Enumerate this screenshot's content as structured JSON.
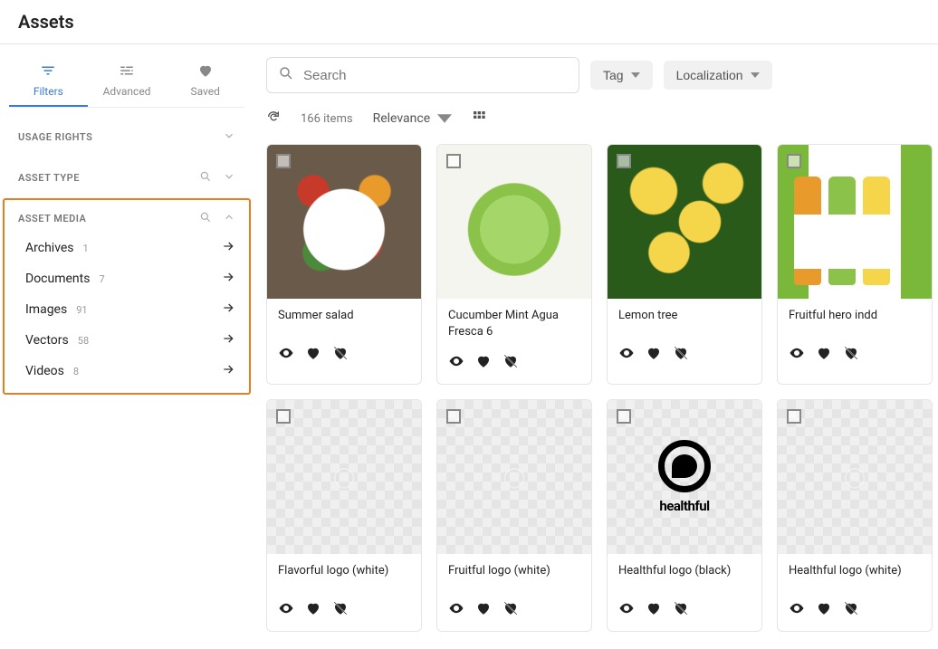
{
  "page": {
    "title": "Assets"
  },
  "tabs": [
    {
      "label": "Filters",
      "active": true
    },
    {
      "label": "Advanced",
      "active": false
    },
    {
      "label": "Saved",
      "active": false
    }
  ],
  "filters": {
    "usage_rights": {
      "label": "USAGE RIGHTS"
    },
    "asset_type": {
      "label": "ASSET TYPE"
    },
    "asset_media": {
      "label": "ASSET MEDIA",
      "items": [
        {
          "label": "Archives",
          "count": "1"
        },
        {
          "label": "Documents",
          "count": "7"
        },
        {
          "label": "Images",
          "count": "91"
        },
        {
          "label": "Vectors",
          "count": "58"
        },
        {
          "label": "Videos",
          "count": "8"
        }
      ]
    }
  },
  "search": {
    "placeholder": "Search"
  },
  "topbar": {
    "tag_label": "Tag",
    "localization_label": "Localization"
  },
  "toolbar": {
    "count_text": "166 items",
    "sort_label": "Relevance"
  },
  "assets": [
    {
      "title": "Summer salad",
      "thumb_class": "salad"
    },
    {
      "title": "Cucumber Mint Agua Fresca 6",
      "thumb_class": "cucumber"
    },
    {
      "title": "Lemon tree",
      "thumb_class": "lemon"
    },
    {
      "title": "Fruitful hero indd",
      "thumb_class": "bottles"
    },
    {
      "title": "Flavorful logo (white)",
      "thumb_class": "checker",
      "white_logo": true
    },
    {
      "title": "Fruitful logo (white)",
      "thumb_class": "checker",
      "white_logo": true
    },
    {
      "title": "Healthful logo (black)",
      "thumb_class": "checker",
      "healthful_black": true
    },
    {
      "title": "Healthful logo (white)",
      "thumb_class": "checker",
      "white_logo": true
    }
  ]
}
